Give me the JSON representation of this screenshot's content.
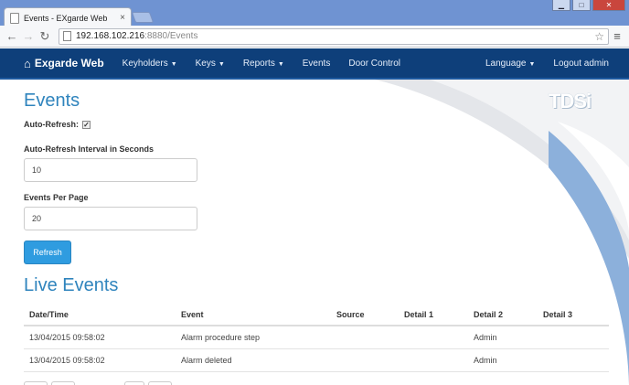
{
  "browser": {
    "tab_title": "Events - EXgarde Web",
    "tab_close": "×",
    "url_host": "192.168.102.216",
    "url_rest": ":8880/Events",
    "star_icon": "☆",
    "menu_icon": "≡",
    "window_buttons": [
      "▁",
      "□",
      "✕"
    ]
  },
  "nav": {
    "brand": "Exgarde Web",
    "home_icon": "⌂",
    "items": [
      {
        "label": "Keyholders",
        "dropdown": true
      },
      {
        "label": "Keys",
        "dropdown": true
      },
      {
        "label": "Reports",
        "dropdown": true
      },
      {
        "label": "Events",
        "dropdown": false
      },
      {
        "label": "Door Control",
        "dropdown": false
      }
    ],
    "language": "Language",
    "logout": "Logout admin",
    "caret": "▼"
  },
  "logo": {
    "text": "TDSi",
    "colors": {
      "outline": "#9fb3c6"
    }
  },
  "page": {
    "title": "Events",
    "auto_refresh_label": "Auto-Refresh:",
    "auto_refresh_checked": "✓",
    "interval_label": "Auto-Refresh Interval in Seconds",
    "interval_value": "10",
    "per_page_label": "Events Per Page",
    "per_page_value": "20",
    "refresh_button": "Refresh",
    "live_title": "Live Events"
  },
  "table": {
    "headers": [
      "Date/Time",
      "Event",
      "Source",
      "Detail 1",
      "Detail 2",
      "Detail 3"
    ],
    "rows": [
      [
        "13/04/2015 09:58:02",
        "Alarm procedure step",
        "",
        "",
        "Admin",
        ""
      ],
      [
        "13/04/2015 09:58:02",
        "Alarm deleted",
        "",
        "",
        "Admin",
        ""
      ]
    ]
  },
  "colors": {
    "navbar": "#0e3f7a",
    "accent": "#2f84bd",
    "button": "#2f9ce0",
    "swoosh_gray": "#e2e4e8",
    "swoosh_blue": "#7fa6d6"
  }
}
